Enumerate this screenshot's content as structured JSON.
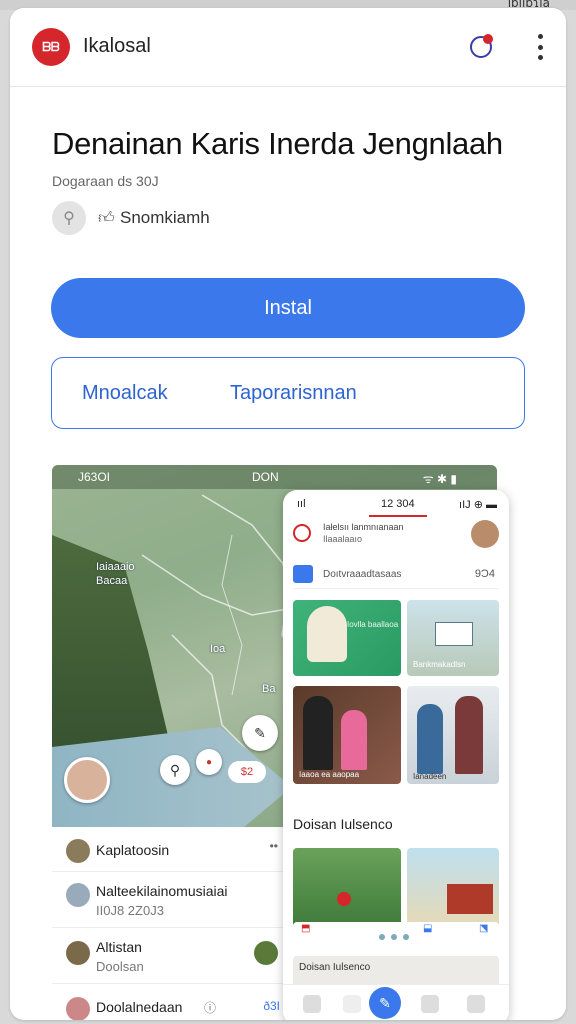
{
  "top_tag": "ıɒiıɒɿıa",
  "app": {
    "logo_text": "ᗷᗷ",
    "name": "Ikalosal"
  },
  "listing": {
    "title": "Denainan Karis Inerda Jengnlaah",
    "subtitle": "Dogaraan ds 30J",
    "rating_label": "Snomkiamh"
  },
  "buttons": {
    "install": "Instal",
    "left": "Mnoalcak",
    "right": "Taporarisnnan"
  },
  "map_panel": {
    "status_left": "J63OI",
    "status_center": "DON",
    "status_right": "ᯤ ✱ ▮",
    "labels": [
      "Iaiaaaio",
      "Bacaa",
      "Ioa",
      "Ba"
    ],
    "chip": "$2"
  },
  "list_items": [
    {
      "title": "Kaplatoosin",
      "sub": ""
    },
    {
      "title": "Nalteekilainomusiaiai",
      "sub": "II0J8 2Z0J3"
    },
    {
      "title": "Altistan",
      "sub": "Doolsan"
    },
    {
      "title": "Doolalnedaan",
      "sub": ""
    }
  ],
  "list_last_right": "ð3I",
  "phone": {
    "status_left": "ııl",
    "status_center": "12 304",
    "status_right": "ıIJ ⊕ ▬",
    "header_title": "Iałelsıı lanmnıanaan",
    "header_sub": "Ilaaalaaıo",
    "search_text": "Doıtvraaadtasaas",
    "search_right": "9Ɔ4",
    "section_title": "Doisan Iulsenco",
    "tile_caps": [
      "Iovlla baallaoa",
      "Bankmakadlsn",
      "Iaaoa ea aaopaa",
      "Ianadeen"
    ]
  },
  "colors": {
    "accent": "#3b78ec",
    "brand": "#d4262b"
  }
}
